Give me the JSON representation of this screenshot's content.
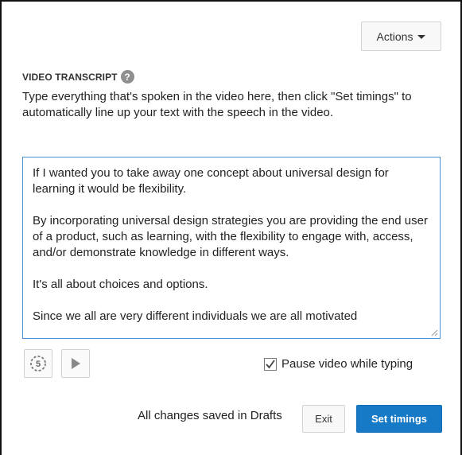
{
  "header": {
    "actions_label": "Actions"
  },
  "transcript_section": {
    "title": "VIDEO TRANSCRIPT",
    "help_icon": "?",
    "description": "Type everything that's spoken in the video here, then click \"Set timings\" to automatically line up your text with the speech in the video.",
    "paragraphs": [
      "If I wanted you to take away one concept about universal design for learning it would be flexibility.",
      "By incorporating universal design strategies you are providing the end user of a product, such as learning, with the flexibility to engage with, access, and/or demonstrate knowledge in different ways.",
      "It's all about choices and options.",
      "Since we all are very different individuals we are all motivated"
    ]
  },
  "playback": {
    "replay_label": "5",
    "replay_icon": "replay-5-seconds-icon",
    "play_icon": "play-icon",
    "pause_while_typing_label": "Pause video while typing",
    "pause_while_typing_checked": true
  },
  "footer": {
    "status": "All changes saved in Drafts",
    "exit_label": "Exit",
    "set_timings_label": "Set timings"
  },
  "colors": {
    "primary": "#167ac6",
    "focus_border": "#4a90d9",
    "icon_gray": "#8f8f8f"
  }
}
